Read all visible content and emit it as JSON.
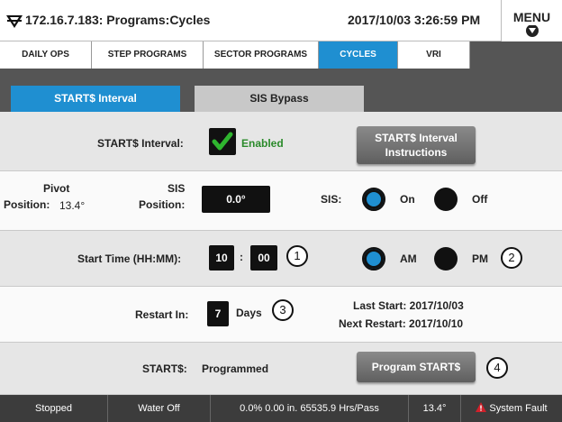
{
  "header": {
    "title": "172.16.7.183: Programs:Cycles",
    "datetime": "2017/10/03 3:26:59 PM",
    "menu_label": "MENU"
  },
  "nav_tabs": [
    {
      "label": "DAILY OPS"
    },
    {
      "label": "STEP PROGRAMS"
    },
    {
      "label": "SECTOR PROGRAMS"
    },
    {
      "label": "CYCLES",
      "active": true
    },
    {
      "label": "VRI"
    }
  ],
  "sub_tabs": [
    {
      "label": "START$ Interval",
      "active": true
    },
    {
      "label": "SIS Bypass"
    }
  ],
  "interval": {
    "label": "START$ Interval:",
    "status": "Enabled",
    "instructions_button": "START$ Interval Instructions"
  },
  "pivot": {
    "label_line1": "Pivot",
    "label_line2": "Position:",
    "value": "13.4°"
  },
  "sis": {
    "position_label_line1": "SIS",
    "position_label_line2": "Position:",
    "position_value": "0.0°",
    "label": "SIS:",
    "on_label": "On",
    "off_label": "Off",
    "selected": "On"
  },
  "start_time": {
    "label": "Start Time (HH:MM):",
    "hours": "10",
    "separator": ":",
    "minutes": "00",
    "am_label": "AM",
    "pm_label": "PM",
    "selected": "AM"
  },
  "restart": {
    "label": "Restart In:",
    "value": "7",
    "unit": "Days",
    "last_start": "Last Start: 2017/10/03",
    "next_restart": "Next Restart: 2017/10/10"
  },
  "starts": {
    "label": "START$:",
    "value": "Programmed",
    "program_button": "Program START$"
  },
  "callouts": [
    "1",
    "2",
    "3",
    "4"
  ],
  "status_bar": {
    "state": "Stopped",
    "water": "Water Off",
    "readout": "0.0%  0.00 in.  65535.9 Hrs/Pass",
    "angle": "13.4°",
    "fault": "System Fault"
  },
  "colors": {
    "accent": "#1f8fd1",
    "enabled_text": "#2a8a2a",
    "check_green": "#2fb52f",
    "fault_red": "#d0202a"
  }
}
